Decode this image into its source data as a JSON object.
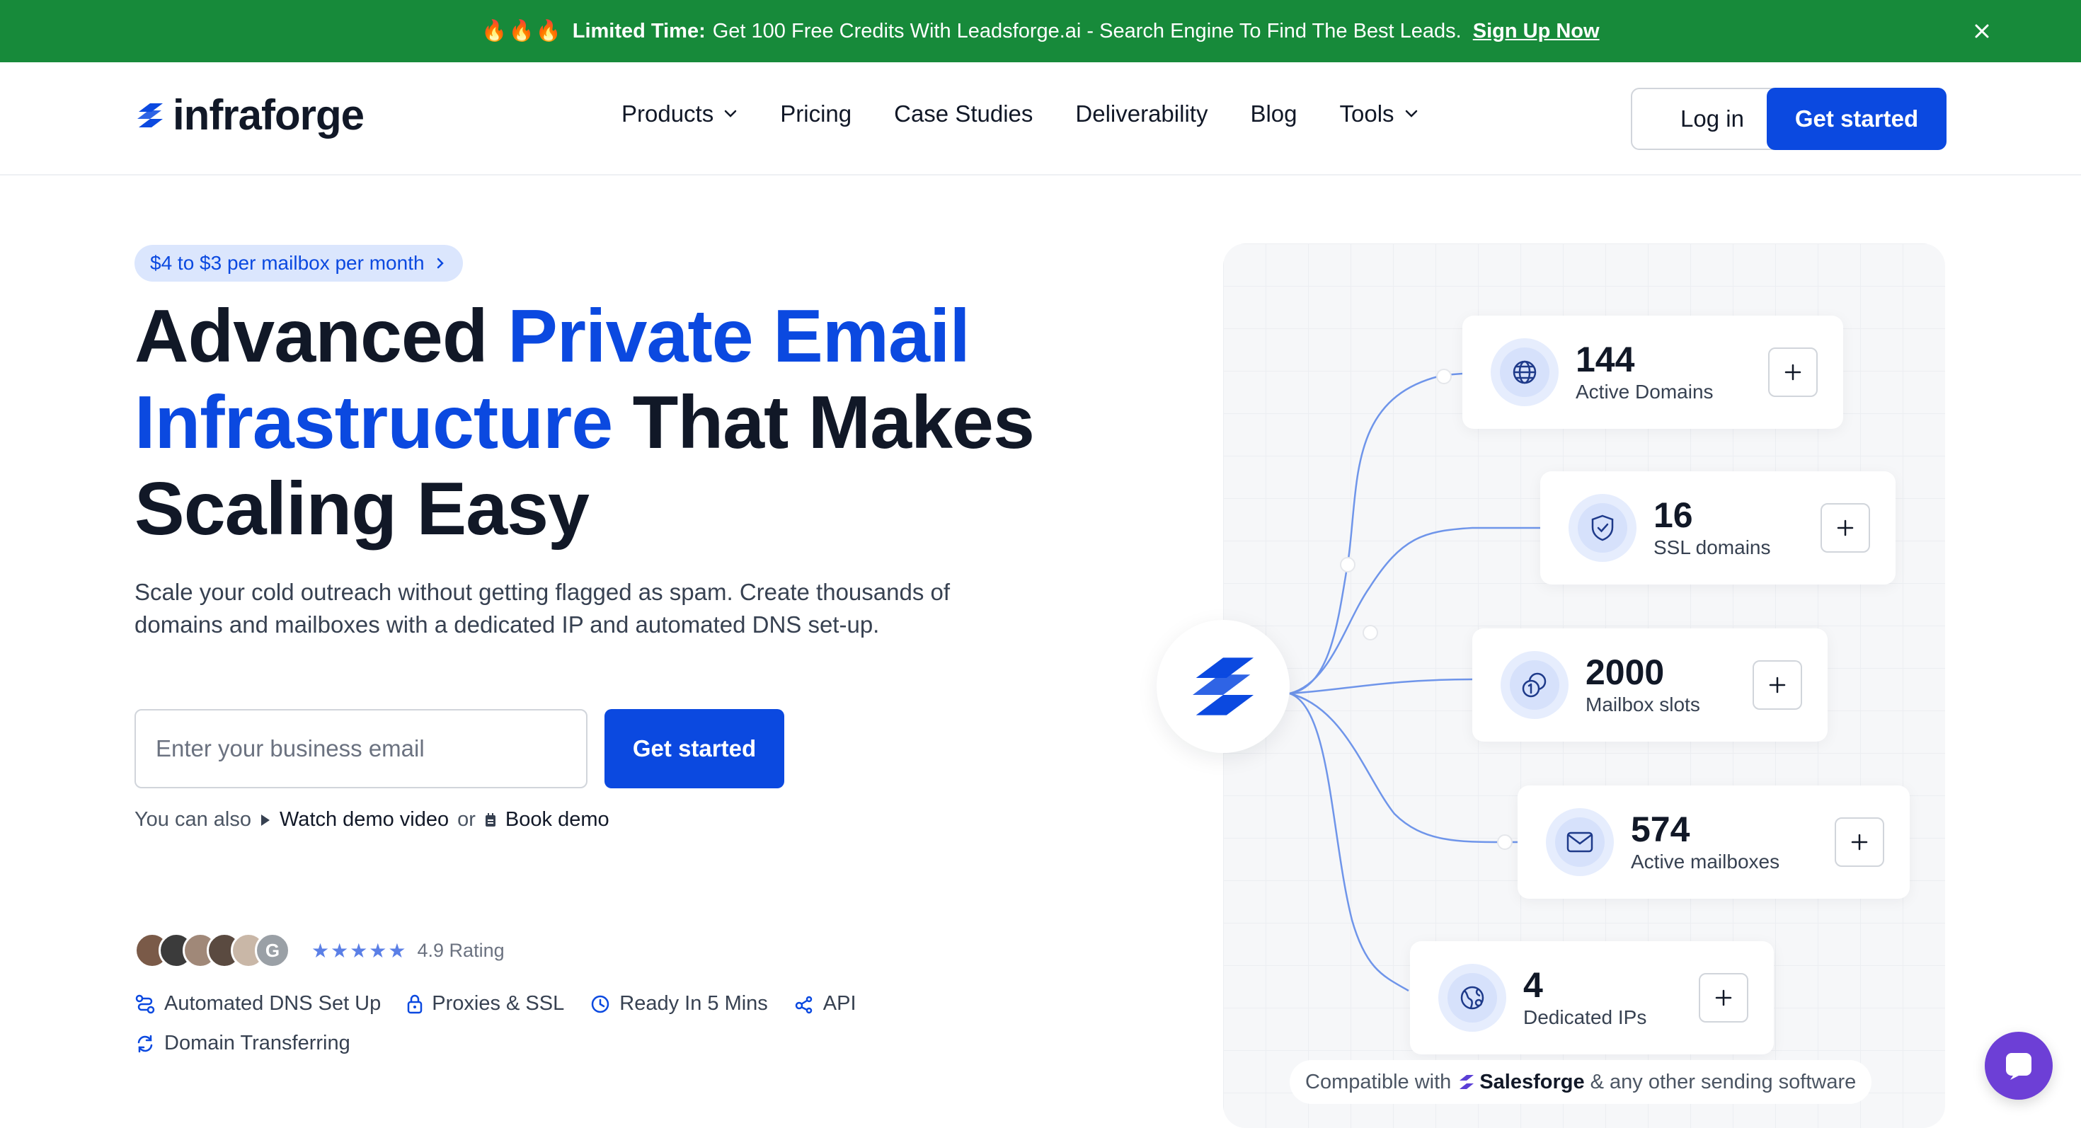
{
  "banner": {
    "fires": "🔥🔥🔥",
    "strong": "Limited Time:",
    "text": "Get 100 Free Credits With Leadsforge.ai - Search Engine To Find The Best Leads.",
    "link": "Sign Up Now",
    "bg_color": "#178a3a"
  },
  "header": {
    "logo_text": "infraforge",
    "nav": [
      {
        "label": "Products",
        "has_dropdown": true
      },
      {
        "label": "Pricing"
      },
      {
        "label": "Case Studies"
      },
      {
        "label": "Deliverability"
      },
      {
        "label": "Blog"
      },
      {
        "label": "Tools",
        "has_dropdown": true
      }
    ],
    "login": "Log in",
    "cta": "Get started"
  },
  "hero": {
    "promo": "$4 to $3 per mailbox per month",
    "headline": {
      "part1": "Advanced ",
      "highlight1": "Private Email",
      "highlight2": "Infrastructure",
      "part2": " That Makes",
      "part3": "Scaling Easy"
    },
    "subtext": "Scale your cold outreach without getting flagged as spam. Create thousands of domains and mailboxes with a dedicated IP and automated DNS set-up.",
    "email_placeholder": "Enter your business email",
    "cta": "Get started",
    "alt_prefix": "You can also",
    "watch_demo": "Watch demo video",
    "or": "or",
    "book_demo": "Book demo",
    "rating": "4.9 Rating",
    "stars": "★★★★★",
    "features": [
      "Automated DNS Set Up",
      "Proxies & SSL",
      "Ready In 5 Mins",
      "API",
      "Domain Transferring"
    ]
  },
  "stats": [
    {
      "value": "144",
      "label": "Active Domains",
      "icon": "globe-icon"
    },
    {
      "value": "16",
      "label": "SSL domains",
      "icon": "shield-check-icon"
    },
    {
      "value": "2000",
      "label": "Mailbox slots",
      "icon": "coins-icon"
    },
    {
      "value": "574",
      "label": "Active mailboxes",
      "icon": "mail-icon"
    },
    {
      "value": "4",
      "label": "Dedicated IPs",
      "icon": "network-globe-icon"
    }
  ],
  "compat": {
    "prefix": "Compatible with",
    "brand": "Salesforge",
    "suffix": "& any other sending software"
  },
  "colors": {
    "accent": "#0b49e0",
    "chat": "#6d3fd6"
  }
}
